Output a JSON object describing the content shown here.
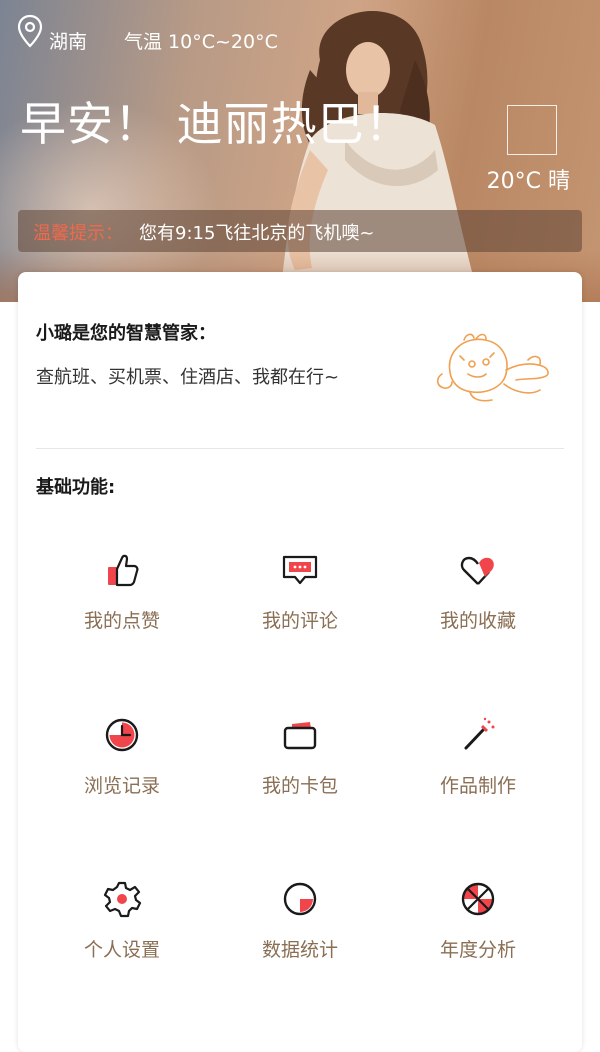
{
  "header": {
    "city": "湖南",
    "temperature_label": "气温 10°C~20°C",
    "greeting": "早安！ 迪丽热巴！",
    "weather": "20°C 晴"
  },
  "tip": {
    "label": "温馨提示：",
    "message": "您有9:15飞往北京的飞机噢~"
  },
  "intro": {
    "title": "小璐是您的智慧管家：",
    "description": "查航班、买机票、住酒店、我都在行~"
  },
  "basic": {
    "title": "基础功能:",
    "items": [
      {
        "label": "我的点赞",
        "icon": "thumbs-up-icon"
      },
      {
        "label": "我的评论",
        "icon": "comment-icon"
      },
      {
        "label": "我的收藏",
        "icon": "favorite-icon"
      },
      {
        "label": "浏览记录",
        "icon": "history-clock-icon"
      },
      {
        "label": "我的卡包",
        "icon": "wallet-icon"
      },
      {
        "label": "作品制作",
        "icon": "magic-wand-icon"
      },
      {
        "label": "个人设置",
        "icon": "gear-icon"
      },
      {
        "label": "数据统计",
        "icon": "pie-chart-icon"
      },
      {
        "label": "年度分析",
        "icon": "analysis-ball-icon"
      }
    ]
  },
  "colors": {
    "accent_red": "#f0454b",
    "label_brown": "#8a6f54",
    "tip_orange": "#ef6a4c",
    "mascot_orange": "#f0a050"
  }
}
